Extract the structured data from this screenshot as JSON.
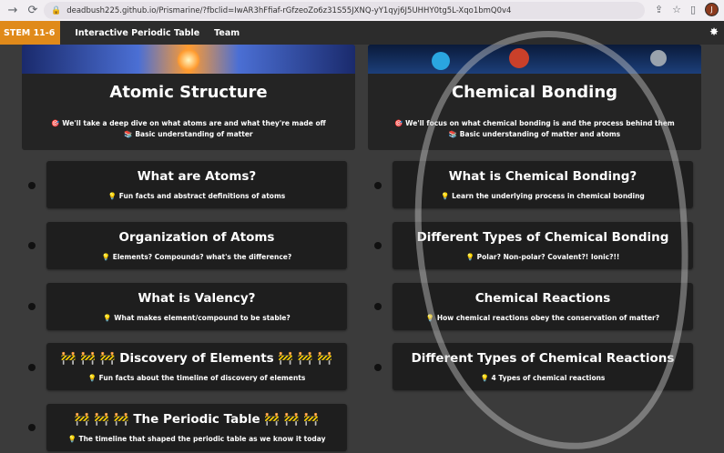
{
  "browser": {
    "url": "deadbush225.github.io/Prismarine/?fbclid=IwAR3hFfiaf-rGfzeoZo6z31S55JXNQ-yY1qyj6J5UHHY0tg5L-Xqo1bmQ0v4",
    "profile_initial": "J"
  },
  "nav": {
    "brand": "STEM 11-6",
    "links": [
      "Interactive Periodic Table",
      "Team"
    ]
  },
  "heroes": [
    {
      "title": "Atomic Structure",
      "line1": "🎯 We'll take a deep dive on what atoms are and what they're made off",
      "line2": "📚 Basic understanding of matter"
    },
    {
      "title": "Chemical Bonding",
      "line1": "🎯 We'll focus on what chemical bonding is and the process behind them",
      "line2": "📚 Basic understanding of matter and atoms"
    }
  ],
  "left_cards": [
    {
      "title": "What are Atoms?",
      "sub": "Fun facts and abstract definitions of atoms"
    },
    {
      "title": "Organization of Atoms",
      "sub": "Elements? Compounds? what's the difference?"
    },
    {
      "title": "What is Valency?",
      "sub": "What makes element/compound to be stable?"
    },
    {
      "title": "🚧 🚧 🚧 Discovery of Elements 🚧 🚧 🚧",
      "sub": "Fun facts about the timeline of discovery of elements"
    },
    {
      "title": "🚧 🚧 🚧 The Periodic Table 🚧 🚧 🚧",
      "sub": "The timeline that shaped the periodic table as we know it today"
    }
  ],
  "right_cards": [
    {
      "title": "What is Chemical Bonding?",
      "sub": "Learn the underlying process in chemical bonding"
    },
    {
      "title": "Different Types of Chemical Bonding",
      "sub": "Polar? Non-polar? Covalent?! Ionic?!!"
    },
    {
      "title": "Chemical Reactions",
      "sub": "How chemical reactions obey the conservation of matter?"
    },
    {
      "title": "Different Types of Chemical Reactions",
      "sub": "4 Types of chemical reactions"
    }
  ],
  "bulb_icon": "💡"
}
